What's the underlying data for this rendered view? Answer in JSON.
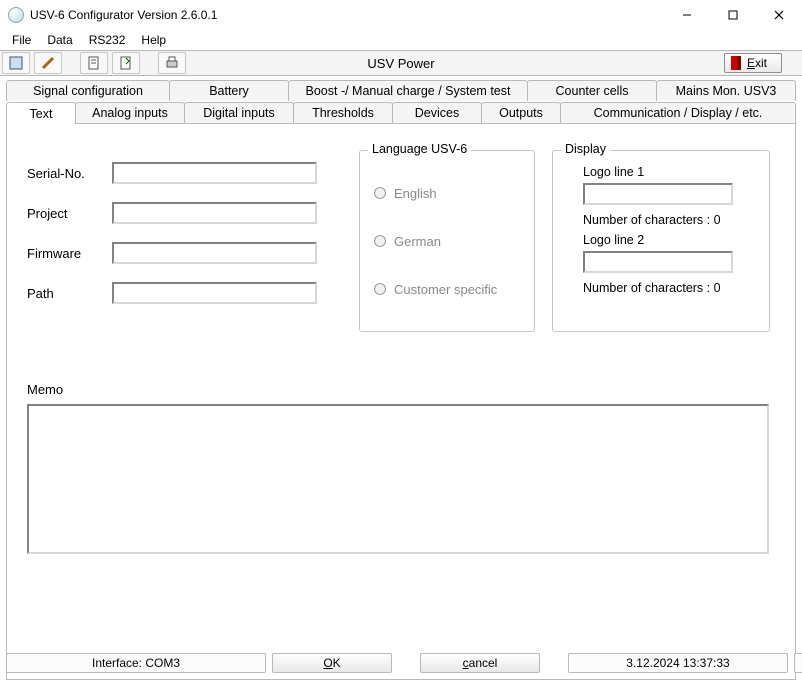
{
  "window": {
    "title": "USV-6 Configurator Version 2.6.0.1"
  },
  "menu": {
    "file": "File",
    "data": "Data",
    "rs232": "RS232",
    "help": "Help"
  },
  "toolbar": {
    "center_label": "USV Power",
    "exit_label": "Exit"
  },
  "tabs_top": {
    "signal": "Signal configuration",
    "battery": "Battery",
    "boost": "Boost -/ Manual  charge / System test",
    "counter": "Counter cells",
    "mains": "Mains Mon. USV3"
  },
  "tabs_bottom": {
    "text": "Text",
    "analog": "Analog inputs",
    "digital": "Digital inputs",
    "thresholds": "Thresholds",
    "devices": "Devices",
    "outputs": "Outputs",
    "comm": "Communication / Display / etc."
  },
  "fields": {
    "serial_label": "Serial-No.",
    "serial_value": "",
    "project_label": "Project",
    "project_value": "",
    "firmware_label": "Firmware",
    "firmware_value": "",
    "path_label": "Path",
    "path_value": ""
  },
  "language": {
    "legend": "Language USV-6",
    "english": "English",
    "german": "German",
    "customer": "Customer specific"
  },
  "display": {
    "legend": "Display",
    "logo1_label": "Logo line 1",
    "logo1_value": "",
    "chars1": "Number of characters :  0",
    "logo2_label": "Logo line 2",
    "logo2_value": "",
    "chars2": "Number of characters :  0"
  },
  "memo": {
    "label": "Memo",
    "value": ""
  },
  "status": {
    "interface": "Interface: COM3",
    "ok": "OK",
    "cancel": "cancel",
    "datetime": "3.12.2024       13:37:33"
  }
}
